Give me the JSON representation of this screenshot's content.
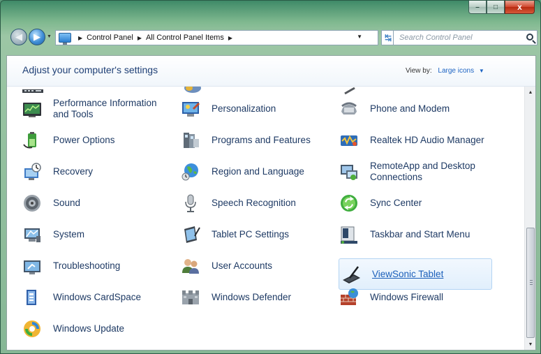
{
  "window": {
    "controls": {
      "minimize": "–",
      "maximize": "□",
      "close": "x"
    }
  },
  "navbar": {
    "breadcrumbs": [
      "Control Panel",
      "All Control Panel Items"
    ],
    "search_placeholder": "Search Control Panel"
  },
  "header": {
    "title": "Adjust your computer's settings",
    "view_by_label": "View by:",
    "view_by_value": "Large icons"
  },
  "items": [
    {
      "label": "Performance Information and Tools",
      "icon": "performance-icon",
      "selected": false
    },
    {
      "label": "Personalization",
      "icon": "personalization-icon",
      "selected": false
    },
    {
      "label": "Phone and Modem",
      "icon": "phone-icon",
      "selected": false
    },
    {
      "label": "Power Options",
      "icon": "power-icon",
      "selected": false
    },
    {
      "label": "Programs and Features",
      "icon": "programs-icon",
      "selected": false
    },
    {
      "label": "Realtek HD Audio Manager",
      "icon": "audio-manager-icon",
      "selected": false
    },
    {
      "label": "Recovery",
      "icon": "recovery-icon",
      "selected": false
    },
    {
      "label": "Region and Language",
      "icon": "globe-icon",
      "selected": false
    },
    {
      "label": "RemoteApp and Desktop Connections",
      "icon": "remoteapp-icon",
      "selected": false
    },
    {
      "label": "Sound",
      "icon": "speaker-icon",
      "selected": false
    },
    {
      "label": "Speech Recognition",
      "icon": "microphone-icon",
      "selected": false
    },
    {
      "label": "Sync Center",
      "icon": "sync-icon",
      "selected": false
    },
    {
      "label": "System",
      "icon": "system-icon",
      "selected": false
    },
    {
      "label": "Tablet PC Settings",
      "icon": "tablet-icon",
      "selected": false
    },
    {
      "label": "Taskbar and Start Menu",
      "icon": "taskbar-icon",
      "selected": false
    },
    {
      "label": "Troubleshooting",
      "icon": "troubleshooting-icon",
      "selected": false
    },
    {
      "label": "User Accounts",
      "icon": "users-icon",
      "selected": false
    },
    {
      "label": "ViewSonic Tablet",
      "icon": "pen-tablet-icon",
      "selected": true
    },
    {
      "label": "Windows CardSpace",
      "icon": "cardspace-icon",
      "selected": false
    },
    {
      "label": "Windows Defender",
      "icon": "defender-icon",
      "selected": false
    },
    {
      "label": "Windows Firewall",
      "icon": "firewall-icon",
      "selected": false
    },
    {
      "label": "Windows Update",
      "icon": "update-icon",
      "selected": false
    }
  ],
  "colors": {
    "link": "#1e3a64",
    "selected_link": "#1b5fba",
    "heading": "#1e3f75"
  }
}
